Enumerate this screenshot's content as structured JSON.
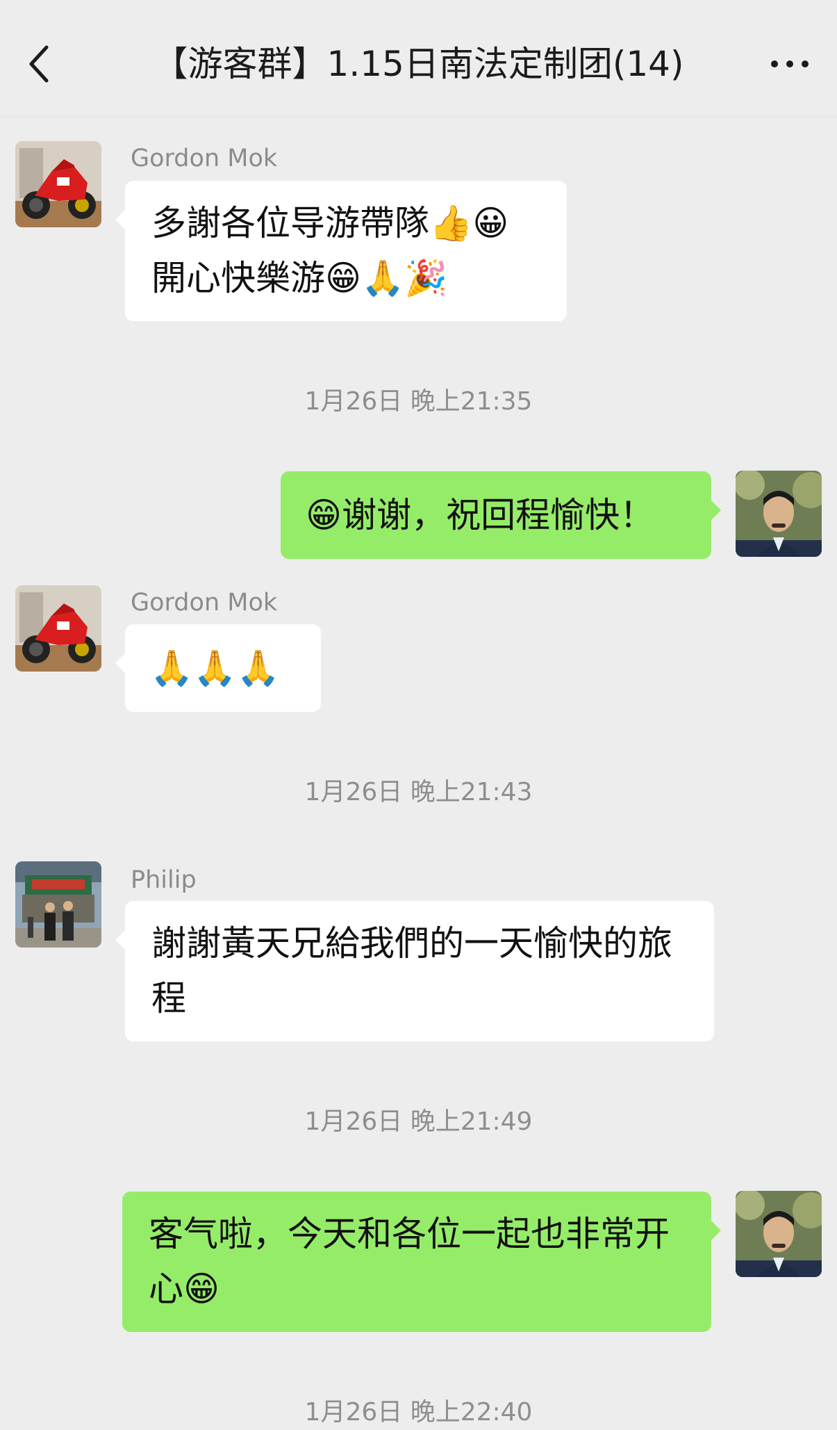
{
  "header": {
    "title": "【游客群】1.15日南法定制团(14)",
    "back_icon": "chevron-left-icon",
    "more_icon": "more-dots-icon"
  },
  "colors": {
    "background": "#ededed",
    "incoming_bubble": "#ffffff",
    "outgoing_bubble": "#95ec69",
    "timestamp_text": "#8e8e8e",
    "sender_name_text": "#8b8b8b"
  },
  "messages": [
    {
      "direction": "in",
      "sender": "Gordon Mok",
      "avatar": "red-motorcycle-avatar",
      "lines": [
        "多謝各位导游帶隊👍😀",
        "開心快樂游😁🙏🎉"
      ]
    },
    {
      "timestamp": "1月26日 晚上21:35"
    },
    {
      "direction": "out",
      "avatar": "self-portrait-avatar",
      "lines": [
        "😁谢谢，祝回程愉快！"
      ]
    },
    {
      "direction": "in",
      "sender": "Gordon Mok",
      "avatar": "red-motorcycle-avatar",
      "lines": [
        "🙏🙏🙏"
      ]
    },
    {
      "timestamp": "1月26日 晚上21:43"
    },
    {
      "direction": "in",
      "sender": "Philip",
      "avatar": "group-photo-avatar",
      "lines": [
        "謝謝黃天兄給我們的一天愉快的旅",
        "程"
      ]
    },
    {
      "timestamp": "1月26日 晚上21:49"
    },
    {
      "direction": "out",
      "avatar": "self-portrait-avatar",
      "lines": [
        "客气啦，今天和各位一起也非常开",
        "心😁"
      ]
    },
    {
      "timestamp": "1月26日 晚上22:40"
    }
  ]
}
